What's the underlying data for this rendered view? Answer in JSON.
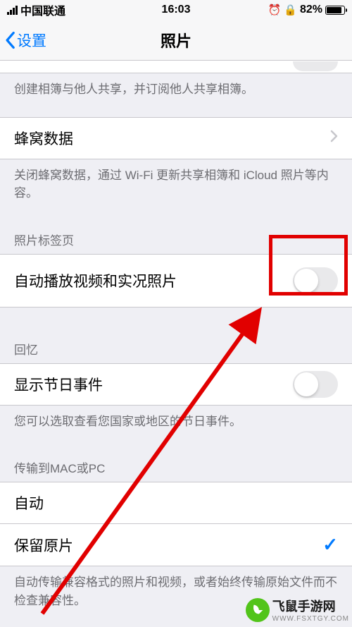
{
  "status": {
    "carrier": "中国联通",
    "time": "16:03",
    "battery_pct": "82%"
  },
  "nav": {
    "back_label": "设置",
    "title": "照片"
  },
  "top_footer": "创建相簿与他人共享，并订阅他人共享相簿。",
  "cellular": {
    "label": "蜂窝数据",
    "footer": "关闭蜂窝数据，通过 Wi-Fi 更新共享相簿和 iCloud 照片等内容。"
  },
  "tabs": {
    "header": "照片标签页",
    "row_label": "自动播放视频和实况照片",
    "toggle_on": false
  },
  "memories": {
    "header": "回忆",
    "row_label": "显示节日事件",
    "toggle_on": false,
    "footer": "您可以选取查看您国家或地区的节日事件。"
  },
  "transfer": {
    "header": "传输到MAC或PC",
    "option_auto": "自动",
    "option_keep": "保留原片",
    "selected": "keep",
    "footer": "自动传输兼容格式的照片和视频，或者始终传输原始文件而不检查兼容性。"
  },
  "watermark": {
    "name": "飞鼠手游网",
    "domain": "WWW.FSXTGY.COM"
  }
}
